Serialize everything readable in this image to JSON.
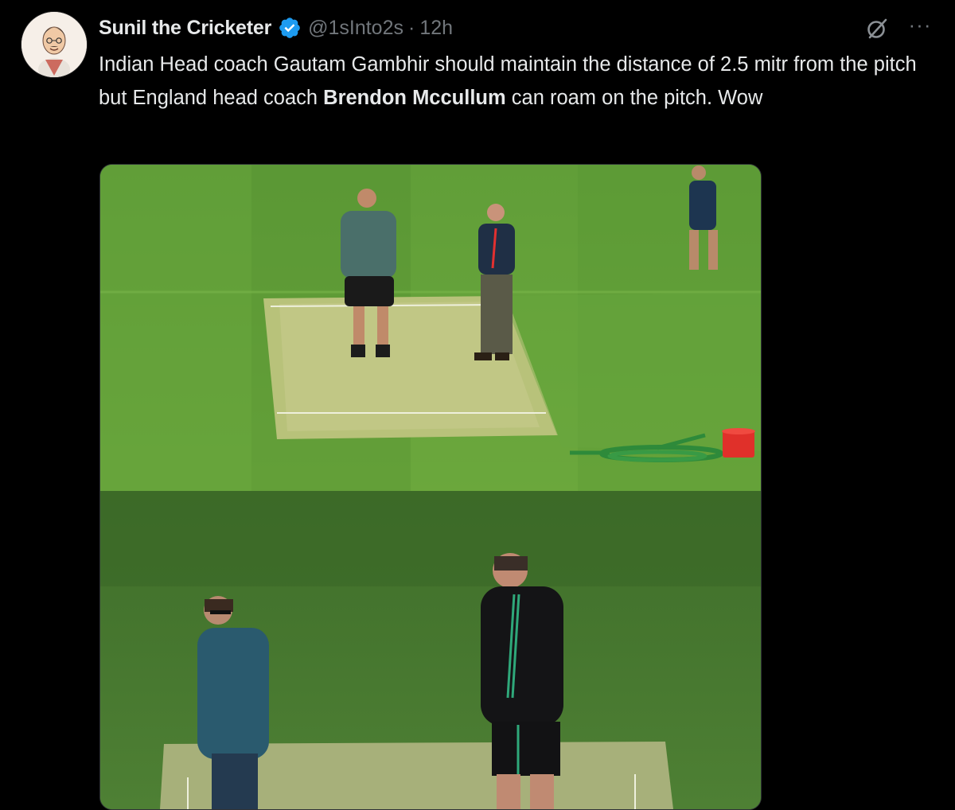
{
  "tweet": {
    "display_name": "Sunil the Cricketer",
    "handle": "@1sInto2s",
    "separator": "·",
    "time": "12h",
    "text_part1": "Indian Head coach Gautam Gambhir should maintain the distance of 2.5 mitr from the pitch but England head coach ",
    "text_bold": "Brendon Mccullum",
    "text_part2": " can roam on the pitch. Wow"
  },
  "icons": {
    "verified": "verified-badge-icon",
    "grok": "grok-icon",
    "more": "more-options-icon"
  },
  "colors": {
    "background": "#000000",
    "text": "#e7e9ea",
    "secondary": "#71767b",
    "verified": "#1d9bf0"
  }
}
